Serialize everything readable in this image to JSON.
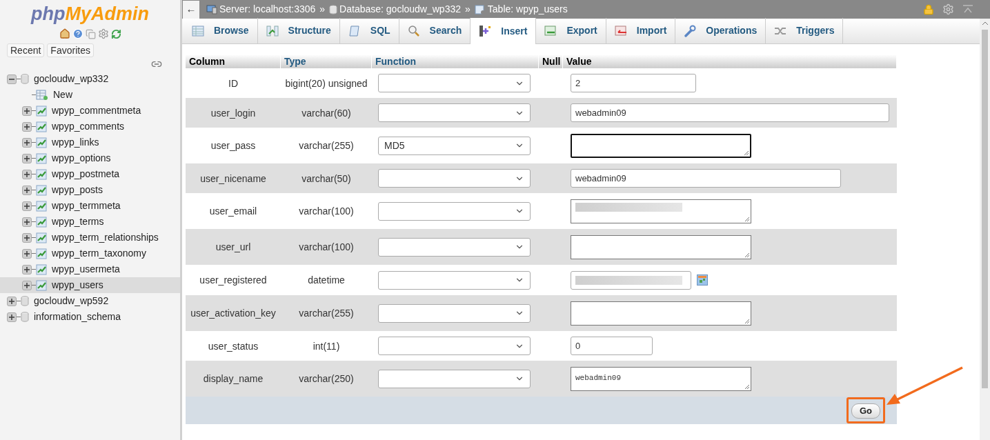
{
  "sidebar": {
    "logo": {
      "part1": "php",
      "part2": "MyAdmin"
    },
    "buttons": [
      {
        "label": "Recent"
      },
      {
        "label": "Favorites"
      }
    ],
    "tree": [
      {
        "label": "gocloudw_wp332",
        "kind": "database",
        "expanded": true,
        "selected": false,
        "children": [
          {
            "label": "New",
            "kind": "new",
            "selected": false
          },
          {
            "label": "wpyp_commentmeta",
            "kind": "table",
            "selected": false
          },
          {
            "label": "wpyp_comments",
            "kind": "table",
            "selected": false
          },
          {
            "label": "wpyp_links",
            "kind": "table",
            "selected": false
          },
          {
            "label": "wpyp_options",
            "kind": "table",
            "selected": false
          },
          {
            "label": "wpyp_postmeta",
            "kind": "table",
            "selected": false
          },
          {
            "label": "wpyp_posts",
            "kind": "table",
            "selected": false
          },
          {
            "label": "wpyp_termmeta",
            "kind": "table",
            "selected": false
          },
          {
            "label": "wpyp_terms",
            "kind": "table",
            "selected": false
          },
          {
            "label": "wpyp_term_relationships",
            "kind": "table",
            "selected": false
          },
          {
            "label": "wpyp_term_taxonomy",
            "kind": "table",
            "selected": false
          },
          {
            "label": "wpyp_usermeta",
            "kind": "table",
            "selected": false
          },
          {
            "label": "wpyp_users",
            "kind": "table",
            "selected": true
          }
        ]
      },
      {
        "label": "gocloudw_wp592",
        "kind": "database",
        "expanded": false,
        "selected": false
      },
      {
        "label": "information_schema",
        "kind": "database",
        "expanded": false,
        "selected": false
      }
    ]
  },
  "breadcrumb": [
    {
      "kind": "server",
      "label": "Server: localhost:3306"
    },
    {
      "kind": "database",
      "label": "Database: gocloudw_wp332"
    },
    {
      "kind": "table",
      "label": "Table: wpyp_users"
    }
  ],
  "breadcrumb_separator": "»",
  "back_button": "←",
  "tabs": [
    {
      "label": "Browse",
      "kind": "browse",
      "selected": false
    },
    {
      "label": "Structure",
      "kind": "structure",
      "selected": false
    },
    {
      "label": "SQL",
      "kind": "sql",
      "selected": false
    },
    {
      "label": "Search",
      "kind": "search",
      "selected": false
    },
    {
      "label": "Insert",
      "kind": "insert",
      "selected": true
    },
    {
      "label": "Export",
      "kind": "export",
      "selected": false
    },
    {
      "label": "Import",
      "kind": "import",
      "selected": false
    },
    {
      "label": "Operations",
      "kind": "operations",
      "selected": false
    },
    {
      "label": "Triggers",
      "kind": "triggers",
      "selected": false
    }
  ],
  "table": {
    "columns": [
      "Column",
      "Type",
      "Function",
      "Null",
      "Value"
    ],
    "rows": [
      {
        "column": "ID",
        "type": "bigint(20) unsigned",
        "function": "",
        "value": {
          "kind": "short",
          "text": "2"
        }
      },
      {
        "column": "user_login",
        "type": "varchar(60)",
        "function": "",
        "value": {
          "kind": "wide",
          "text": "webadmin09"
        }
      },
      {
        "column": "user_pass",
        "type": "varchar(255)",
        "function": "MD5",
        "value": {
          "kind": "textarea",
          "focused": true
        }
      },
      {
        "column": "user_nicename",
        "type": "varchar(50)",
        "function": "",
        "value": {
          "kind": "medium",
          "text": "webadmin09"
        }
      },
      {
        "column": "user_email",
        "type": "varchar(100)",
        "function": "",
        "value": {
          "kind": "textarea",
          "focused": false,
          "redacted": true
        }
      },
      {
        "column": "user_url",
        "type": "varchar(100)",
        "function": "",
        "value": {
          "kind": "textarea",
          "focused": false
        }
      },
      {
        "column": "user_registered",
        "type": "datetime",
        "function": "",
        "value": {
          "kind": "date",
          "redacted": true
        }
      },
      {
        "column": "user_activation_key",
        "type": "varchar(255)",
        "function": "",
        "value": {
          "kind": "textarea",
          "focused": false
        }
      },
      {
        "column": "user_status",
        "type": "int(11)",
        "function": "",
        "value": {
          "kind": "tiny",
          "text": "0"
        }
      },
      {
        "column": "display_name",
        "type": "varchar(250)",
        "function": "",
        "value": {
          "kind": "textarea",
          "text": "webadmin09",
          "focused": false,
          "mono": true
        }
      }
    ]
  },
  "go_button": {
    "label": "Go",
    "highlighted": true
  }
}
